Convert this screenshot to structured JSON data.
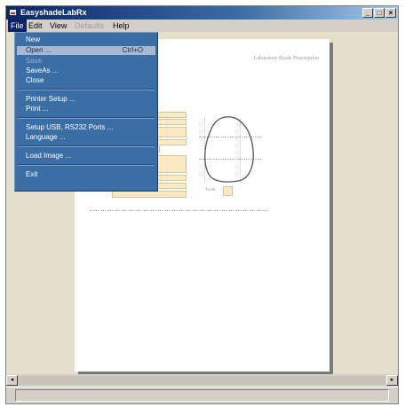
{
  "window": {
    "title": "EasyshadeLabRx",
    "buttons": {
      "minimize": "_",
      "maximize": "□",
      "close": "×"
    }
  },
  "menubar": {
    "items": [
      {
        "label": "File",
        "state": "active"
      },
      {
        "label": "Edit",
        "state": "normal"
      },
      {
        "label": "View",
        "state": "normal"
      },
      {
        "label": "Defaults",
        "state": "disabled"
      },
      {
        "label": "Help",
        "state": "normal"
      }
    ]
  },
  "file_menu": {
    "items": [
      {
        "label": "New",
        "state": "normal"
      },
      {
        "label": "Open ...",
        "shortcut": "Ctrl+O",
        "state": "highlighted"
      },
      {
        "label": "Save",
        "state": "disabled"
      },
      {
        "label": "SaveAs ...",
        "state": "normal"
      },
      {
        "label": "Close",
        "state": "normal"
      },
      {
        "label": "Printer Setup ...",
        "state": "normal"
      },
      {
        "label": "Print ...",
        "state": "normal"
      },
      {
        "label": "Setup USB, RS232 Ports ...",
        "state": "normal"
      },
      {
        "label": "Language ...",
        "state": "normal"
      },
      {
        "label": "Load Image ...",
        "state": "normal"
      },
      {
        "label": "Exit",
        "state": "normal"
      }
    ]
  },
  "document": {
    "header_title": "Laboratory Shade Prescription",
    "tooth_label": "Tooth"
  },
  "scrollbar": {
    "left_arrow": "◂",
    "right_arrow": "▸"
  },
  "status": {
    "text": ""
  },
  "colors": {
    "titlebar": "#0a246a",
    "menu_bg": "#3a6ea5",
    "menu_highlight": "#a8b8d0",
    "field_fill": "#fbe9c6",
    "workspace": "#e4e0cc"
  }
}
